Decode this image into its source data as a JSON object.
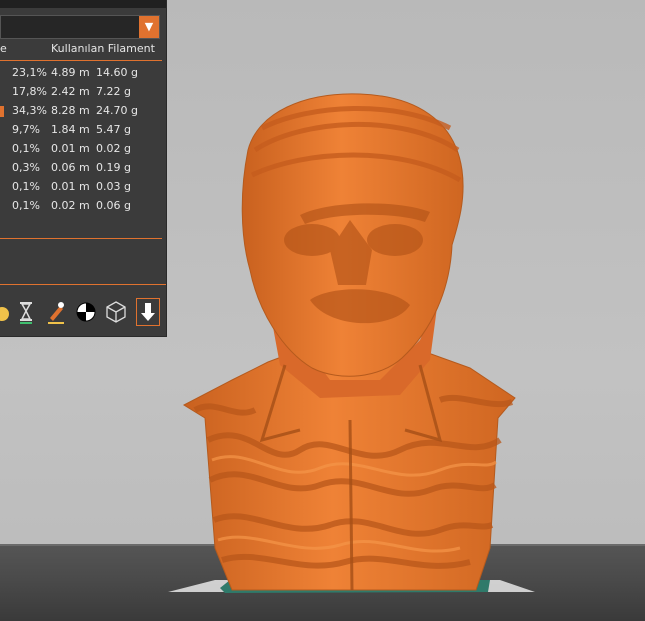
{
  "panel": {
    "dropdown_value": "",
    "dropdown_icon": "chevron-down-icon",
    "header_partial": "e",
    "header_filament": "Kullanılan Filament",
    "accent_color": "#e0722f",
    "rows": [
      {
        "percent": "23,1%",
        "length": "4.89 m",
        "weight": "14.60 g",
        "selected": false
      },
      {
        "percent": "17,8%",
        "length": "2.42 m",
        "weight": "7.22 g",
        "selected": false
      },
      {
        "percent": "34,3%",
        "length": "8.28 m",
        "weight": "24.70 g",
        "selected": true
      },
      {
        "percent": "9,7%",
        "length": "1.84 m",
        "weight": "5.47 g",
        "selected": false
      },
      {
        "percent": "0,1%",
        "length": "0.01 m",
        "weight": "0.02 g",
        "selected": false
      },
      {
        "percent": "0,3%",
        "length": "0.06 m",
        "weight": "0.19 g",
        "selected": false
      },
      {
        "percent": "0,1%",
        "length": "0.01 m",
        "weight": "0.03 g",
        "selected": false
      },
      {
        "percent": "0,1%",
        "length": "0.02 m",
        "weight": "0.06 g",
        "selected": false
      }
    ],
    "toolbar": [
      {
        "icon": "fill-color-icon"
      },
      {
        "icon": "hourglass-icon"
      },
      {
        "icon": "paint-brush-icon"
      },
      {
        "icon": "center-of-mass-icon"
      },
      {
        "icon": "wireframe-cube-icon"
      },
      {
        "icon": "export-arrow-icon",
        "active": true
      }
    ]
  },
  "viewport": {
    "model_color": "#e9782f",
    "background_color": "#bdbdbd",
    "floor_color": "#4a4a4a"
  }
}
